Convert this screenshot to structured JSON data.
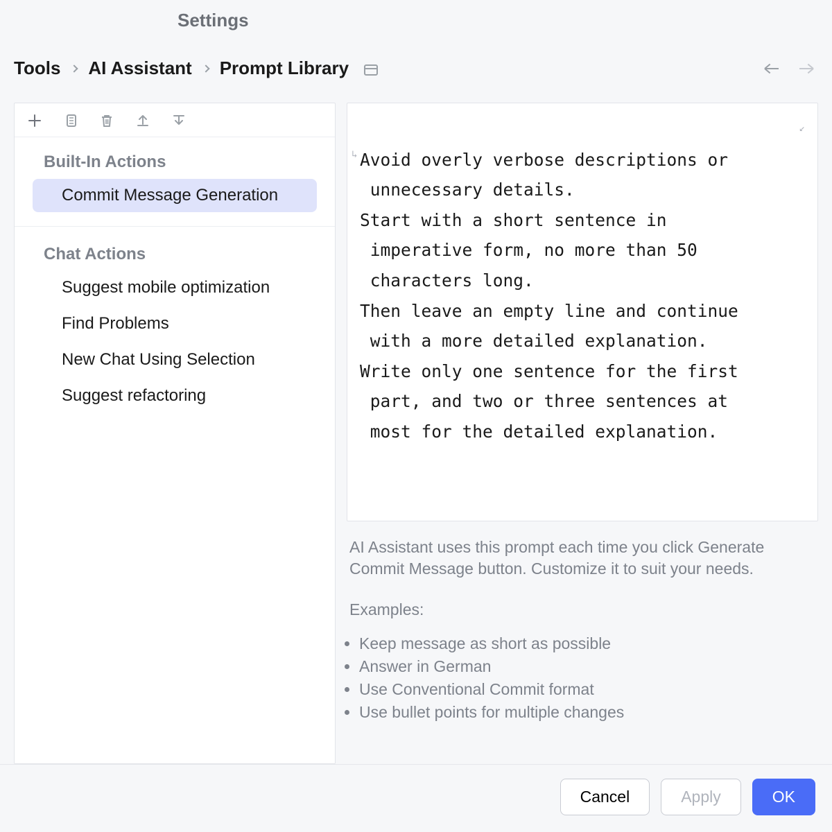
{
  "header": {
    "title": "Settings",
    "breadcrumb": [
      "Tools",
      "AI Assistant",
      "Prompt Library"
    ]
  },
  "left": {
    "sections": [
      {
        "title": "Built-In Actions",
        "items": [
          {
            "label": "Commit Message Generation",
            "selected": true
          }
        ]
      },
      {
        "title": "Chat Actions",
        "items": [
          {
            "label": "Suggest mobile optimization",
            "selected": false
          },
          {
            "label": "Find Problems",
            "selected": false
          },
          {
            "label": "New Chat Using Selection",
            "selected": false
          },
          {
            "label": "Suggest refactoring",
            "selected": false
          }
        ]
      }
    ]
  },
  "editor": {
    "lines": [
      "Avoid overly verbose descriptions or",
      " unnecessary details.",
      "Start with a short sentence in",
      " imperative form, no more than 50",
      " characters long.",
      "Then leave an empty line and continue",
      " with a more detailed explanation.",
      "Write only one sentence for the first",
      " part, and two or three sentences at",
      " most for the detailed explanation."
    ]
  },
  "description": {
    "text": "AI Assistant uses this prompt each time you click Generate Commit Message button. Customize it to suit your needs.",
    "examples_label": "Examples:",
    "examples": [
      "Keep message as short as possible",
      "Answer in German",
      "Use Conventional Commit format",
      "Use bullet points for multiple changes"
    ]
  },
  "footer": {
    "cancel": "Cancel",
    "apply": "Apply",
    "ok": "OK"
  }
}
